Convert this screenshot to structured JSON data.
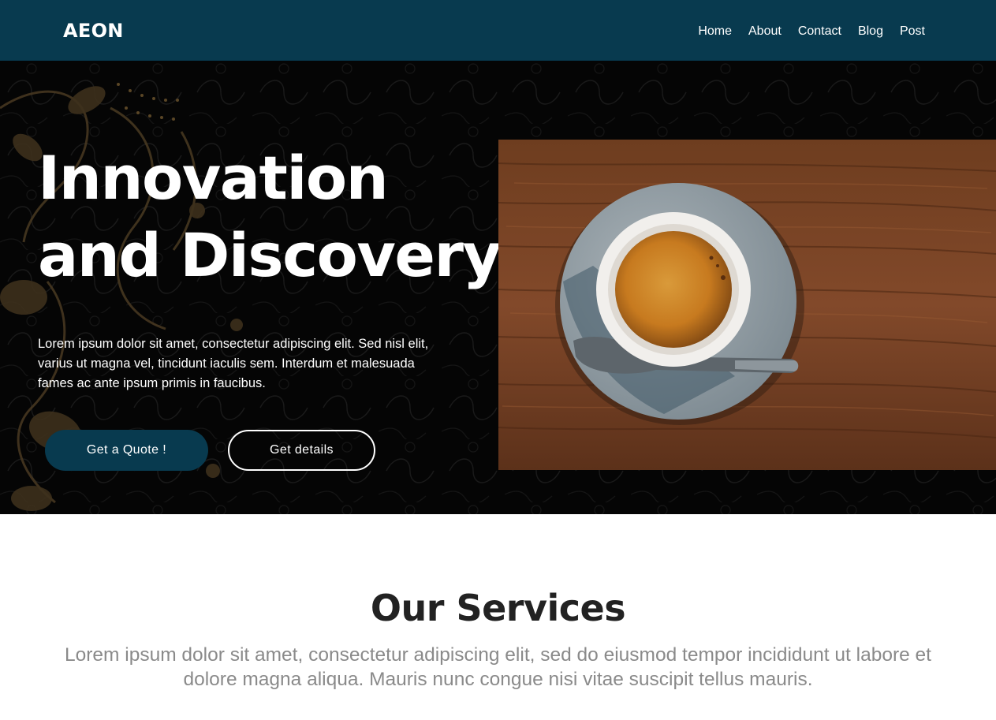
{
  "navbar": {
    "brand": "AEON",
    "links": [
      "Home",
      "About",
      "Contact",
      "Blog",
      "Post"
    ]
  },
  "hero": {
    "title_line1": "Innovation",
    "title_line2": "and Discovery",
    "description": "Lorem ipsum dolor sit amet, consectetur adipiscing elit. Sed nisl elit, varius ut magna vel, tincidunt iaculis sem. Interdum et malesuada fames ac ante ipsum primis in faucibus.",
    "primary_button": "Get a Quote !",
    "secondary_button": "Get details"
  },
  "services": {
    "title": "Our Services",
    "description": "Lorem ipsum dolor sit amet, consectetur adipiscing elit, sed do eiusmod tempor incididunt ut labore et dolore magna aliqua. Mauris nunc congue nisi vitae suscipit tellus mauris."
  },
  "colors": {
    "navbar_bg": "#083a4f",
    "hero_bg": "#050505",
    "primary_button_bg": "#083a4f",
    "text_light": "#ffffff",
    "heading_dark": "#222222",
    "muted_text": "#8a8a8a"
  }
}
